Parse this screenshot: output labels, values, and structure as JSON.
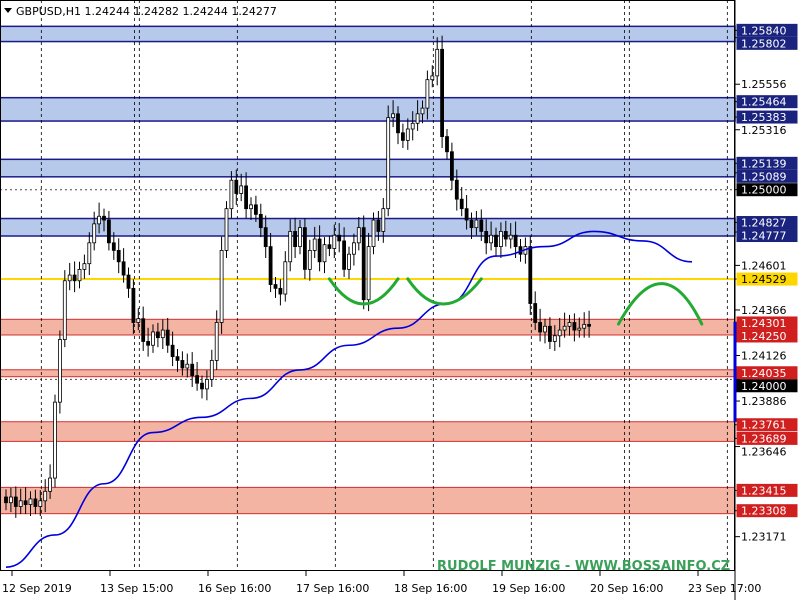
{
  "header": {
    "symbol_title": "GBPUSD,H1  1.24244 1.24282 1.24244 1.24277"
  },
  "watermark": "RUDOLF MUNZIG - WWW.BOSSAINFO.CZ",
  "colors": {
    "bg": "#ffffff",
    "candle": "#000000",
    "grid": "#000000",
    "blue_zone_fill": "#b6c9ea",
    "blue_zone_border": "#1a1a8c",
    "red_zone_fill": "#f4b4a4",
    "red_zone_border": "#d03030",
    "yellow_line": "#ffd700",
    "ma_line": "#0000dd",
    "arc_color": "#22aa33",
    "watermark": "#3aa05a"
  },
  "chart_data": {
    "type": "candlestick",
    "y_range": [
      1.2299,
      1.26
    ],
    "x_ticks": [
      {
        "label": "12 Sep 2019",
        "bar": 0
      },
      {
        "label": "13 Sep 15:00",
        "bar": 20
      },
      {
        "label": "16 Sep 16:00",
        "bar": 40
      },
      {
        "label": "17 Sep 16:00",
        "bar": 60
      },
      {
        "label": "18 Sep 16:00",
        "bar": 80
      },
      {
        "label": "19 Sep 16:00",
        "bar": 100
      },
      {
        "label": "20 Sep 16:00",
        "bar": 120
      },
      {
        "label": "23 Sep 17:00",
        "bar": 140
      }
    ],
    "v_grid_bars": [
      6,
      25,
      26,
      46,
      66,
      86,
      106,
      125,
      126,
      146
    ],
    "h_dotted_levels": [
      1.25,
      1.24
    ],
    "blue_zones": [
      {
        "top": 1.2584,
        "bottom": 1.25802
      },
      {
        "top": 1.25464,
        "bottom": 1.25383
      },
      {
        "top": 1.25139,
        "bottom": 1.25089
      },
      {
        "top": 1.24827,
        "bottom": 1.24777
      }
    ],
    "red_zones": [
      {
        "top": 1.24301,
        "bottom": 1.2425
      },
      {
        "top": 1.24035,
        "bottom": 1.2403
      },
      {
        "top": 1.23761,
        "bottom": 1.23689
      },
      {
        "top": 1.23415,
        "bottom": 1.23308
      }
    ],
    "yellow_level": 1.24529,
    "price_labels": [
      {
        "text": "1.25840",
        "value": 1.2584,
        "style": "blue"
      },
      {
        "text": "1.25802",
        "value": 1.25802,
        "style": "blue"
      },
      {
        "text": "1.25556",
        "value": 1.25556,
        "style": "plain"
      },
      {
        "text": "1.25464",
        "value": 1.25464,
        "style": "blue"
      },
      {
        "text": "1.25383",
        "value": 1.25383,
        "style": "blue"
      },
      {
        "text": "1.25316",
        "value": 1.25316,
        "style": "plain"
      },
      {
        "text": "1.25139",
        "value": 1.25139,
        "style": "blue"
      },
      {
        "text": "1.25089",
        "value": 1.25089,
        "style": "blue"
      },
      {
        "text": "1.25000",
        "value": 1.25,
        "style": "black"
      },
      {
        "text": "1.24827",
        "value": 1.24827,
        "style": "blue"
      },
      {
        "text": "1.24777",
        "value": 1.24777,
        "style": "blue"
      },
      {
        "text": "1.24601",
        "value": 1.24601,
        "style": "plain"
      },
      {
        "text": "1.24529",
        "value": 1.24529,
        "style": "yellow"
      },
      {
        "text": "1.24366",
        "value": 1.24366,
        "style": "plain"
      },
      {
        "text": "1.24301",
        "value": 1.24301,
        "style": "red"
      },
      {
        "text": "1.24250",
        "value": 1.2425,
        "style": "red"
      },
      {
        "text": "1.24126",
        "value": 1.24126,
        "style": "plain"
      },
      {
        "text": "1.24035",
        "value": 1.24035,
        "style": "red"
      },
      {
        "text": "1.24000",
        "value": 1.24,
        "style": "black"
      },
      {
        "text": "1.23886",
        "value": 1.23886,
        "style": "plain"
      },
      {
        "text": "1.23761",
        "value": 1.23761,
        "style": "red"
      },
      {
        "text": "1.23689",
        "value": 1.23689,
        "style": "red"
      },
      {
        "text": "1.23646",
        "value": 1.23646,
        "style": "plain"
      },
      {
        "text": "1.23415",
        "value": 1.23415,
        "style": "red"
      },
      {
        "text": "1.23308",
        "value": 1.23308,
        "style": "red"
      },
      {
        "text": "1.23171",
        "value": 1.23171,
        "style": "plain"
      }
    ],
    "current_price": 1.24277,
    "closes": [
      1.2335,
      1.2338,
      1.2333,
      1.2336,
      1.2334,
      1.2337,
      1.2333,
      1.2336,
      1.2341,
      1.2348,
      1.2388,
      1.2421,
      1.2452,
      1.2455,
      1.2452,
      1.2458,
      1.2461,
      1.2472,
      1.2482,
      1.2486,
      1.2484,
      1.2472,
      1.2468,
      1.2462,
      1.2455,
      1.2448,
      1.243,
      1.2432,
      1.242,
      1.2418,
      1.2425,
      1.2422,
      1.2426,
      1.2418,
      1.2412,
      1.241,
      1.2406,
      1.2408,
      1.2402,
      1.2398,
      1.2395,
      1.24,
      1.241,
      1.243,
      1.2468,
      1.249,
      1.2505,
      1.2498,
      1.2502,
      1.249,
      1.2492,
      1.2487,
      1.248,
      1.247,
      1.245,
      1.2448,
      1.2445,
      1.2462,
      1.2478,
      1.247,
      1.248,
      1.2458,
      1.2468,
      1.2474,
      1.2462,
      1.2471,
      1.2469,
      1.2476,
      1.2473,
      1.2458,
      1.2466,
      1.2472,
      1.248,
      1.2442,
      1.247,
      1.2484,
      1.2478,
      1.249,
      1.2538,
      1.254,
      1.253,
      1.2526,
      1.2532,
      1.2535,
      1.254,
      1.2543,
      1.2558,
      1.256,
      1.2574,
      1.2528,
      1.252,
      1.2505,
      1.2495,
      1.249,
      1.2484,
      1.248,
      1.2484,
      1.2478,
      1.2472,
      1.2476,
      1.247,
      1.2478,
      1.2474,
      1.2476,
      1.247,
      1.2466,
      1.247,
      1.244,
      1.243,
      1.2425,
      1.2428,
      1.242,
      1.2423,
      1.2426,
      1.2428,
      1.243,
      1.2426,
      1.2427,
      1.2429,
      1.2428
    ],
    "ma": [
      [
        0,
        1.2301
      ],
      [
        10,
        1.2318
      ],
      [
        20,
        1.2345
      ],
      [
        30,
        1.2372
      ],
      [
        40,
        1.238
      ],
      [
        50,
        1.239
      ],
      [
        60,
        1.2405
      ],
      [
        70,
        1.2418
      ],
      [
        80,
        1.2427
      ],
      [
        90,
        1.244
      ],
      [
        100,
        1.2465
      ],
      [
        110,
        1.247
      ],
      [
        120,
        1.2478
      ],
      [
        130,
        1.2473
      ],
      [
        140,
        1.2462
      ]
    ],
    "arcs": [
      {
        "bar_from": 66,
        "bar_to": 80,
        "peak_bar": 73,
        "level_top": 1.2453,
        "level_bottom": 1.2437,
        "shape": "smile"
      },
      {
        "bar_from": 82,
        "bar_to": 97,
        "peak_bar": 89,
        "level_top": 1.2453,
        "level_bottom": 1.2437,
        "shape": "smile"
      },
      {
        "bar_from": 125,
        "bar_to": 142,
        "peak_bar": 134,
        "level_top": 1.2456,
        "level_bottom": 1.2445,
        "shape": "frown"
      }
    ]
  }
}
